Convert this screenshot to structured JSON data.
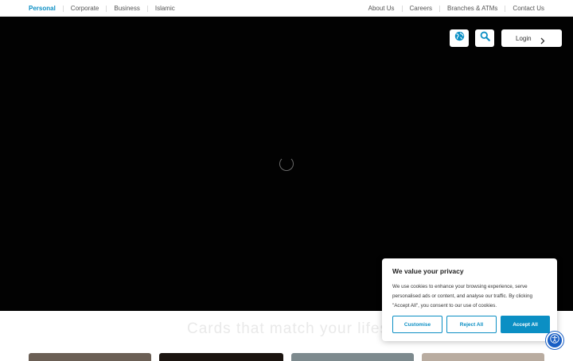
{
  "topnav": {
    "left": [
      {
        "label": "Personal",
        "active": true
      },
      {
        "label": "Corporate",
        "active": false
      },
      {
        "label": "Business",
        "active": false
      },
      {
        "label": "Islamic",
        "active": false
      }
    ],
    "right": [
      {
        "label": "About Us"
      },
      {
        "label": "Careers"
      },
      {
        "label": "Branches & ATMs"
      },
      {
        "label": "Contact Us"
      }
    ]
  },
  "header": {
    "globe_icon": "globe-icon",
    "search_icon": "search-icon",
    "login_label": "Login"
  },
  "hero": {
    "state": "loading"
  },
  "section": {
    "faded_title": "Cards that match your lifestyle"
  },
  "cookie_banner": {
    "title": "We value your privacy",
    "body": "We use cookies to enhance your browsing experience, serve personalised ads or content, and analyse our traffic. By clicking \"Accept All\", you consent to our use of cookies.",
    "customise_label": "Customise",
    "reject_label": "Reject All",
    "accept_label": "Accept All"
  },
  "colors": {
    "accent": "#0b8fc4",
    "hero_bg": "#020202",
    "accessibility": "#1a5fc4"
  }
}
